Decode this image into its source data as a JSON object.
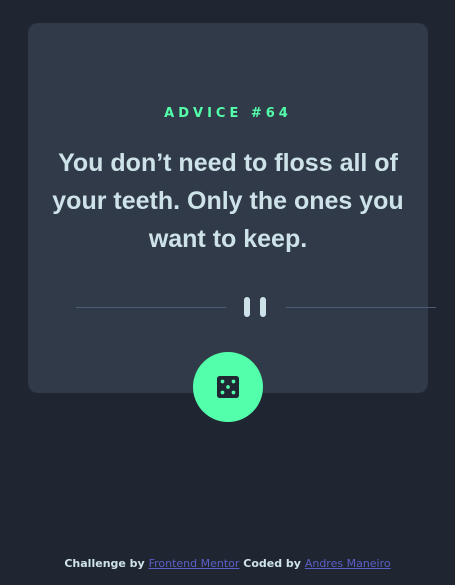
{
  "advice": {
    "id_label": "ADVICE #64",
    "text": "You don’t need to floss all of your teeth. Only the ones you want to keep."
  },
  "dice_button": {
    "icon": "dice-icon"
  },
  "footer": {
    "challenge_prefix": "Challenge by",
    "challenge_link": "Frontend Mentor",
    "coded_prefix": "Coded by",
    "coded_link": "Andres Maneiro"
  },
  "colors": {
    "background": "#1f2632",
    "card": "#313a48",
    "accent": "#53ffaa",
    "text": "#cee3e9",
    "link": "#5c5fc7",
    "divider": "#4f5d74"
  }
}
